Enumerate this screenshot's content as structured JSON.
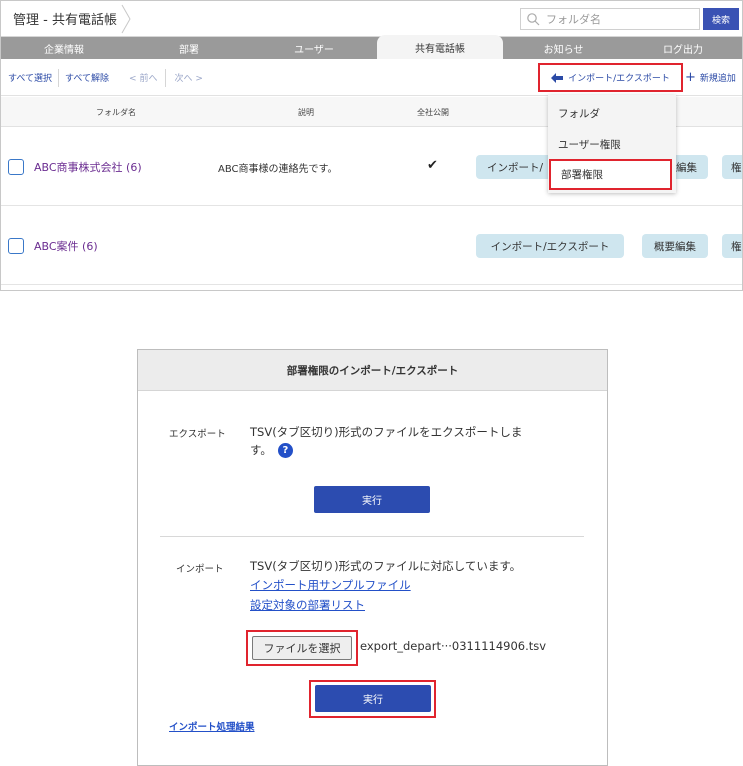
{
  "header": {
    "breadcrumb": "管理 - 共有電話帳",
    "search_placeholder": "フォルダ名",
    "search_button": "検索"
  },
  "tabs": [
    {
      "label": "企業情報",
      "active": false
    },
    {
      "label": "部署",
      "active": false
    },
    {
      "label": "ユーザー",
      "active": false
    },
    {
      "label": "共有電話帳",
      "active": true
    },
    {
      "label": "お知らせ",
      "active": false
    },
    {
      "label": "ログ出力",
      "active": false
    }
  ],
  "toolbar": {
    "select_all": "すべて選択",
    "deselect_all": "すべて解除",
    "prev": "前へ",
    "next": "次へ",
    "import_export": "インポート/エクスポート",
    "add_new": "新規追加"
  },
  "columns": {
    "folder_name": "フォルダ名",
    "description": "説明",
    "public": "全社公開"
  },
  "rows": [
    {
      "name": "ABC商事株式会社 (6)",
      "description": "ABC商事様の連絡先です。",
      "public": "✔",
      "btn_ie": "インポート/エクスポート",
      "btn_edit": "概要編集",
      "btn_perm": "権"
    },
    {
      "name": "ABC案件 (6)",
      "description": "",
      "public": "",
      "btn_ie": "インポート/エクスポート",
      "btn_edit": "概要編集",
      "btn_perm": "権"
    }
  ],
  "row1_partial": {
    "btn_ie": "インポート/",
    "btn_edit": "編集"
  },
  "dropdown": {
    "items": [
      "フォルダ",
      "ユーザー権限",
      "部署権限"
    ]
  },
  "dialog": {
    "title": "部署権限のインポート/エクスポート",
    "export_label": "エクスポート",
    "export_text_1": "TSV(タブ区切り)形式のファイルをエクスポートしま",
    "export_text_2": "す。",
    "execute": "実行",
    "import_label": "インポート",
    "import_text": "TSV(タブ区切り)形式のファイルに対応しています。",
    "sample_link": "インポート用サンプルファイル",
    "dept_list_link": "設定対象の部署リスト",
    "choose_file": "ファイルを選択",
    "file_name": "export_depart···0311114906.tsv",
    "result_link": "インポート処理結果"
  },
  "colors": {
    "accent": "#2c4cb0",
    "highlight": "#e0242e",
    "tab_bar": "#9a9a9a",
    "link": "#2350c8",
    "folder_text": "#6b2d91",
    "pill": "#cfe6ef"
  }
}
